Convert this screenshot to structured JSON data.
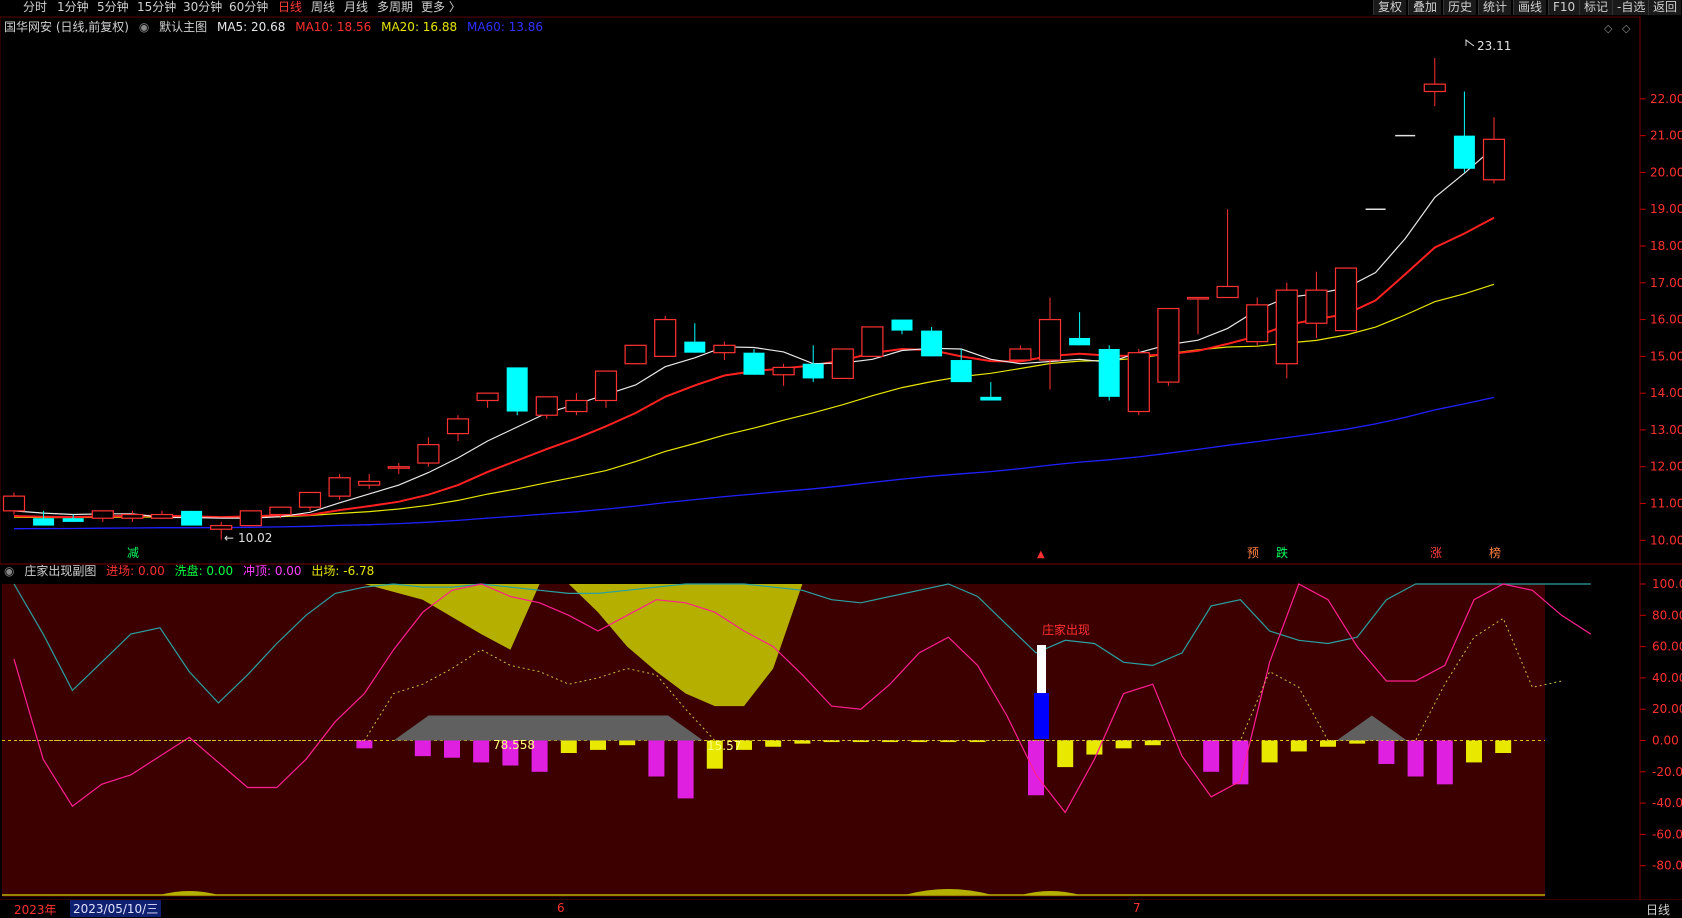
{
  "toolbar": {
    "periods": [
      "分时",
      "1分钟",
      "5分钟",
      "15分钟",
      "30分钟",
      "60分钟",
      "日线",
      "周线",
      "月线",
      "多周期",
      "更多 〉"
    ],
    "active_period": "日线",
    "right_buttons": [
      "复权",
      "叠加",
      "历史",
      "统计",
      "画线",
      "F10",
      "标记",
      "-自选",
      "返回"
    ]
  },
  "main_legend": {
    "name": "国华网安 (日线,前复权)",
    "template": "默认主图",
    "ma5": "MA5: 20.68",
    "ma10": "MA10: 18.56",
    "ma20": "MA20: 16.88",
    "ma60": "MA60: 13.86"
  },
  "sub_legend": {
    "name": "庄家出现副图",
    "jc": "进场: 0.00",
    "xp": "洗盘: 0.00",
    "cd": "冲顶: 0.00",
    "cc": "出场: -6.78"
  },
  "annotations": {
    "high": "23.11",
    "low": "10.02",
    "sub_label1": "78.558",
    "sub_label2": "15.57",
    "zhuangjia": "庄家出现",
    "sig_jian": "减",
    "sig_yu": "预",
    "sig_die": "跌",
    "sig_zhang": "涨",
    "sig_bang": "榜"
  },
  "bottom": {
    "year": "2023年",
    "date": "2023/05/10/三",
    "m6": "6",
    "m7": "7",
    "period": "日线"
  },
  "colors": {
    "up": "#ff3232",
    "down": "#00ffff",
    "ma5": "#e8e8e8",
    "ma10": "#ff2020",
    "ma20": "#e6e600",
    "ma60": "#2020ff",
    "sub_bg": "#3c0000"
  },
  "chart_data": [
    {
      "type": "candlestick",
      "ylim": [
        9.6,
        23.6
      ],
      "yticks": [
        "22.00",
        "21.00",
        "20.00",
        "19.00",
        "18.00",
        "17.00",
        "16.00",
        "15.00",
        "14.00",
        "13.00",
        "12.00",
        "11.00",
        "10.00"
      ],
      "ohlc": [
        [
          10.8,
          11.3,
          10.7,
          11.2
        ],
        [
          10.6,
          10.8,
          10.4,
          10.4
        ],
        [
          10.6,
          10.7,
          10.5,
          10.5
        ],
        [
          10.6,
          10.8,
          10.5,
          10.8
        ],
        [
          10.6,
          10.8,
          10.5,
          10.7
        ],
        [
          10.6,
          10.8,
          10.6,
          10.7
        ],
        [
          10.8,
          10.8,
          10.4,
          10.4
        ],
        [
          10.3,
          10.5,
          10.02,
          10.4
        ],
        [
          10.4,
          10.8,
          10.4,
          10.8
        ],
        [
          10.7,
          10.9,
          10.6,
          10.9
        ],
        [
          10.9,
          11.3,
          10.8,
          11.3
        ],
        [
          11.2,
          11.8,
          11.1,
          11.7
        ],
        [
          11.5,
          11.8,
          11.4,
          11.6
        ],
        [
          12.0,
          12.1,
          11.8,
          12.0
        ],
        [
          12.1,
          12.8,
          12.0,
          12.6
        ],
        [
          12.9,
          13.4,
          12.7,
          13.3
        ],
        [
          13.8,
          14.0,
          13.6,
          14.0
        ],
        [
          14.7,
          14.7,
          13.4,
          13.5
        ],
        [
          13.4,
          13.9,
          13.3,
          13.9
        ],
        [
          13.5,
          14.0,
          13.4,
          13.8
        ],
        [
          13.8,
          14.6,
          13.6,
          14.6
        ],
        [
          14.8,
          15.3,
          14.8,
          15.3
        ],
        [
          15.0,
          16.1,
          15.0,
          16.0
        ],
        [
          15.4,
          15.9,
          15.1,
          15.1
        ],
        [
          15.1,
          15.4,
          14.9,
          15.3
        ],
        [
          15.1,
          15.2,
          14.5,
          14.5
        ],
        [
          14.5,
          14.8,
          14.2,
          14.7
        ],
        [
          14.8,
          15.3,
          14.3,
          14.4
        ],
        [
          14.4,
          15.2,
          14.4,
          15.2
        ],
        [
          15.0,
          15.8,
          15.0,
          15.8
        ],
        [
          16.0,
          16.0,
          15.6,
          15.7
        ],
        [
          15.7,
          15.8,
          15.0,
          15.0
        ],
        [
          14.9,
          15.2,
          14.3,
          14.3
        ],
        [
          13.9,
          14.3,
          13.8,
          13.8
        ],
        [
          14.9,
          15.3,
          14.9,
          15.2
        ],
        [
          14.9,
          16.6,
          14.1,
          16.0
        ],
        [
          15.5,
          16.2,
          15.3,
          15.3
        ],
        [
          15.2,
          15.3,
          13.8,
          13.9
        ],
        [
          13.5,
          15.2,
          13.4,
          15.1
        ],
        [
          14.3,
          16.3,
          14.2,
          16.3
        ],
        [
          16.6,
          16.6,
          15.6,
          16.6
        ],
        [
          16.6,
          19.0,
          16.8,
          16.9
        ],
        [
          15.4,
          16.6,
          15.3,
          16.4
        ],
        [
          14.8,
          17.0,
          14.4,
          16.8
        ],
        [
          15.9,
          17.3,
          15.5,
          16.8
        ],
        [
          15.7,
          17.0,
          15.8,
          17.4
        ],
        [
          19.0,
          19.0,
          19.0,
          19.0
        ],
        [
          21.0,
          21.0,
          21.0,
          21.0
        ],
        [
          22.2,
          23.11,
          21.8,
          22.4
        ],
        [
          21.0,
          22.2,
          20.0,
          20.1
        ],
        [
          19.8,
          21.5,
          19.7,
          20.9
        ]
      ]
    },
    {
      "type": "line",
      "ylim": [
        -100,
        100
      ],
      "yticks": [
        "100.00",
        "80.00",
        "60.00",
        "40.00",
        "20.00",
        "0.00",
        "-20.00",
        "-40.00",
        "-60.00",
        "-80.00"
      ],
      "series_pink": [
        52,
        -12,
        -42,
        -28,
        -22,
        -10,
        2,
        -14,
        -30,
        -30,
        -12,
        12,
        30,
        58,
        82,
        96,
        100,
        92,
        88,
        80,
        70,
        80,
        90,
        88,
        82,
        70,
        60,
        42,
        22,
        20,
        36,
        56,
        66,
        48,
        16,
        -22,
        -46,
        -12,
        30,
        36,
        -10,
        -36,
        -26,
        50,
        100,
        90,
        60,
        38,
        38,
        48,
        90,
        100,
        96,
        80,
        68
      ],
      "series_cyan": [
        100,
        68,
        32,
        50,
        68,
        72,
        44,
        24,
        42,
        62,
        80,
        94,
        98,
        100,
        98,
        98,
        100,
        98,
        96,
        94,
        94,
        96,
        98,
        100,
        100,
        100,
        98,
        96,
        90,
        88,
        92,
        96,
        100,
        92,
        74,
        56,
        64,
        62,
        50,
        48,
        56,
        86,
        90,
        70,
        64,
        62,
        66,
        90,
        100,
        100,
        100,
        100,
        100,
        100,
        100
      ],
      "series_dots": [
        0,
        0,
        0,
        0,
        0,
        0,
        0,
        0,
        0,
        0,
        0,
        0,
        0,
        30,
        36,
        46,
        58,
        48,
        44,
        36,
        40,
        46,
        42,
        20,
        0,
        0,
        0,
        0,
        0,
        0,
        0,
        0,
        0,
        0,
        0,
        0,
        0,
        0,
        0,
        0,
        0,
        0,
        0,
        44,
        34,
        0,
        0,
        0,
        0,
        36,
        66,
        78,
        34,
        38
      ],
      "bars": [
        0,
        0,
        0,
        0,
        0,
        0,
        0,
        0,
        0,
        0,
        0,
        0,
        -5,
        0,
        -10,
        -11,
        -14,
        -16,
        -20,
        -8,
        -6,
        -3,
        -23,
        -37,
        -18,
        -6,
        -4,
        -2,
        -1,
        -1,
        -1,
        -1,
        -1,
        -1,
        0,
        -35,
        -17,
        -9,
        -5,
        -3,
        0,
        -20,
        -28,
        -14,
        -7,
        -4,
        -2,
        -15,
        -23,
        -28,
        -14,
        -8
      ]
    }
  ]
}
